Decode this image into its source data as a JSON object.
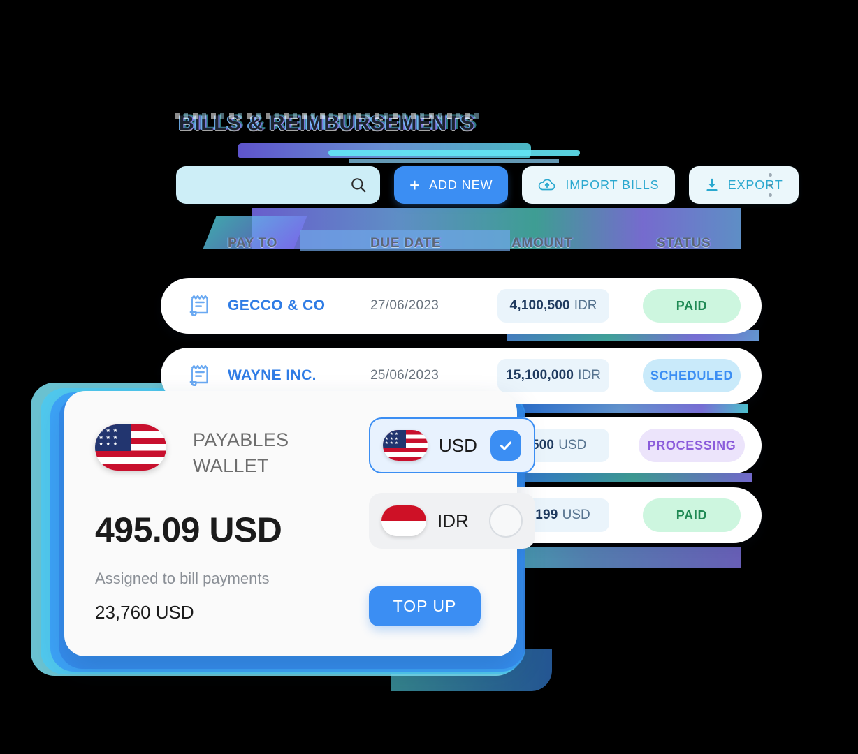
{
  "page": {
    "title": "BILLS & REIMBURSEMENTS"
  },
  "toolbar": {
    "search_value": "",
    "search_placeholder": "",
    "search_icon": "search-icon",
    "add_new_label": "ADD NEW",
    "add_new_icon": "plus-icon",
    "import_label": "IMPORT BILLS",
    "import_icon": "cloud-upload-icon",
    "export_label": "EXPORT",
    "export_icon": "download-icon",
    "overflow_icon": "more-vertical-icon"
  },
  "table": {
    "headers": [
      "PAY TO",
      "DUE DATE",
      "AMOUNT",
      "STATUS"
    ],
    "rows": [
      {
        "icon": "receipt-icon",
        "pay_to": "GECCO & CO",
        "due_date": "27/06/2023",
        "amount": "4,100,500",
        "currency": "IDR",
        "status": "PAID",
        "status_color": "#1f8a54",
        "status_bg": "#cdf6df"
      },
      {
        "icon": "receipt-icon",
        "pay_to": "WAYNE INC.",
        "due_date": "25/06/2023",
        "amount": "15,100,000",
        "currency": "IDR",
        "status": "SCHEDULED",
        "status_color": "#3b8ef3",
        "status_bg": "#c9eafa"
      },
      {
        "icon": "receipt-icon",
        "pay_to": "",
        "due_date": "",
        "amount": "0,500",
        "currency": "USD",
        "status": "PROCESSING",
        "status_color": "#8b5cdb",
        "status_bg": "#ece4fb"
      },
      {
        "icon": "receipt-icon",
        "pay_to": "",
        "due_date": "",
        "amount": "10,199",
        "currency": "USD",
        "status": "PAID",
        "status_color": "#1f8a54",
        "status_bg": "#cdf6df"
      }
    ]
  },
  "wallet": {
    "flag": "us-flag-icon",
    "name": "PAYABLES WALLET",
    "balance": "495.09 USD",
    "assigned_label": "Assigned to bill payments",
    "assigned_value": "23,760 USD",
    "topup_label": "TOP UP",
    "currencies": [
      {
        "code": "USD",
        "flag": "us-flag-icon",
        "selected": true,
        "check_icon": "check-icon"
      },
      {
        "code": "IDR",
        "flag": "id-flag-icon",
        "selected": false,
        "check_icon": ""
      }
    ]
  },
  "theme": {
    "accent": "#3b8ef3",
    "accent_light": "#ebf7fb",
    "link": "#2f7ce5",
    "search_bg": "#cdeef7"
  }
}
